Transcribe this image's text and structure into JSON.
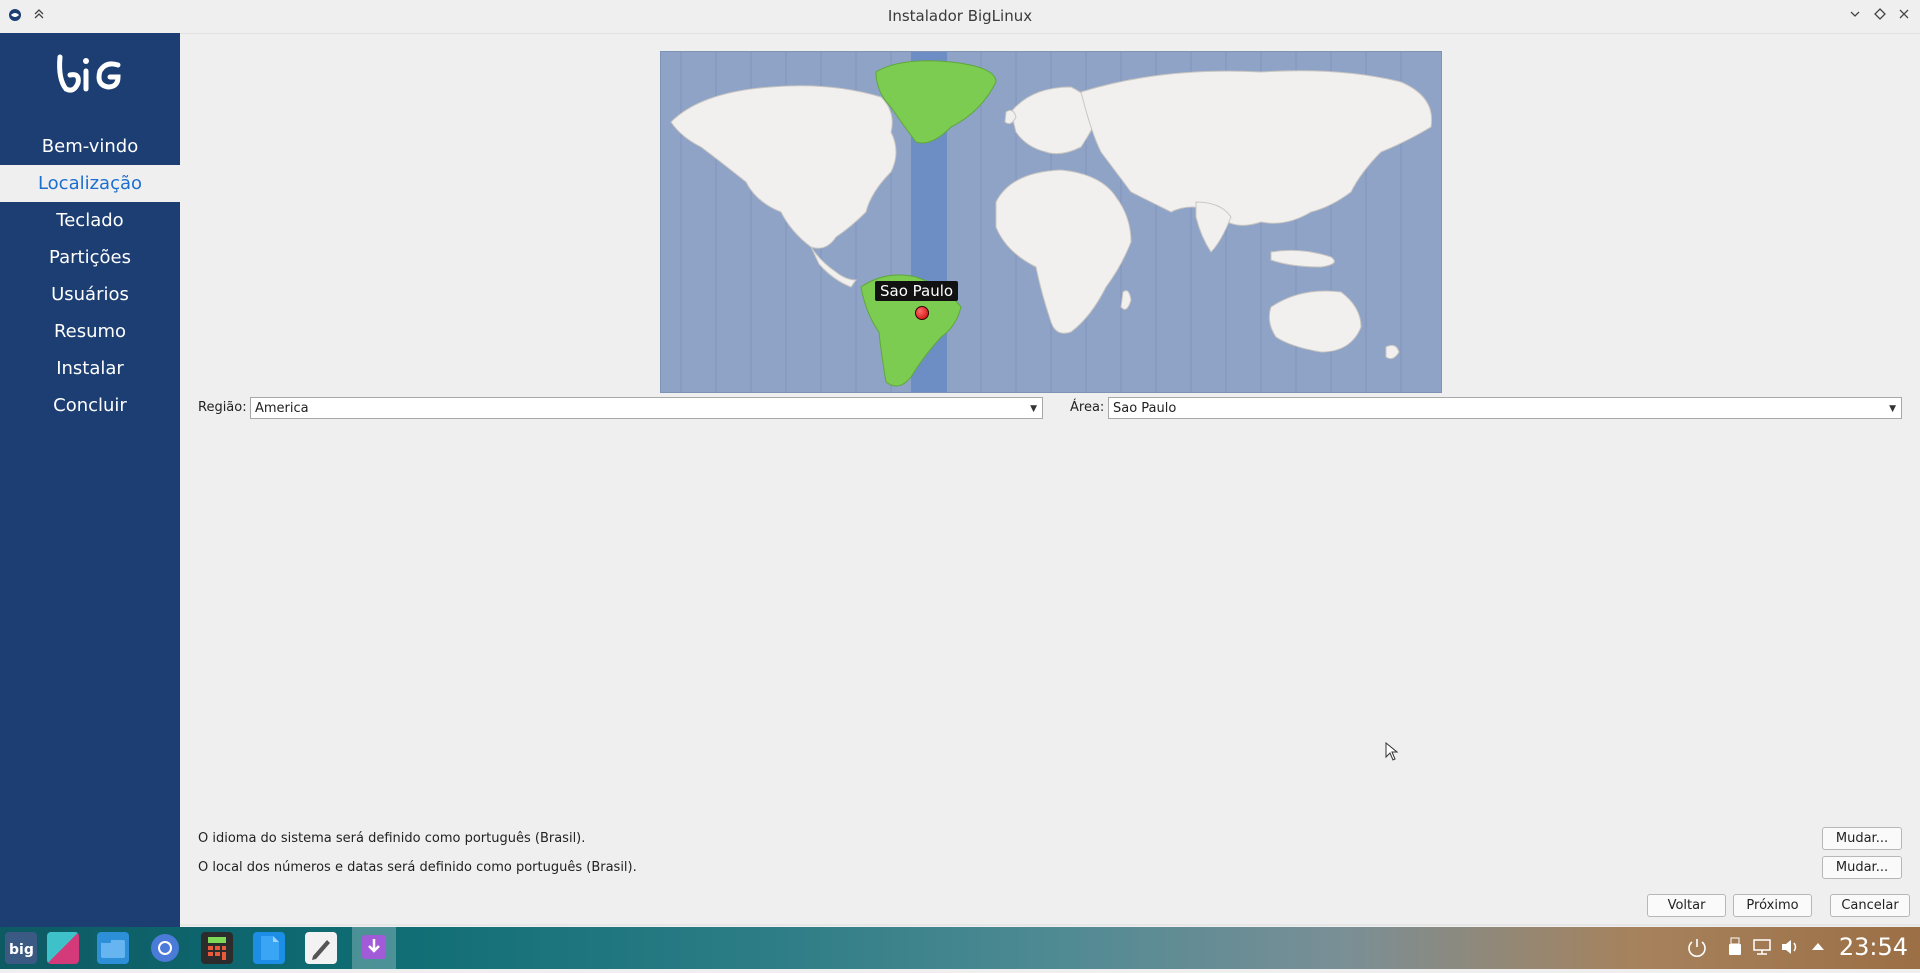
{
  "window": {
    "title": "Instalador BigLinux",
    "left_controls": [
      "app-menu-icon",
      "keep-above-icon"
    ],
    "right_controls": [
      "minimize-icon",
      "maximize-icon",
      "close-icon"
    ]
  },
  "sidebar": {
    "logo_text": "big",
    "items": [
      {
        "label": "Bem-vindo",
        "active": false
      },
      {
        "label": "Localização",
        "active": true
      },
      {
        "label": "Teclado",
        "active": false
      },
      {
        "label": "Partições",
        "active": false
      },
      {
        "label": "Usuários",
        "active": false
      },
      {
        "label": "Resumo",
        "active": false
      },
      {
        "label": "Instalar",
        "active": false
      },
      {
        "label": "Concluir",
        "active": false
      }
    ]
  },
  "map": {
    "selected_city": "Sao Paulo",
    "colors": {
      "ocean": "#8fa3c6",
      "land": "#f2f0ee",
      "selected": "#7ccc52",
      "zone_band": "#6d8ec4"
    }
  },
  "region": {
    "label": "Região:",
    "value": "America"
  },
  "area": {
    "label": "Área:",
    "value": "Sao Paulo"
  },
  "locale": {
    "language_text": "O idioma do sistema será definido como português (Brasil).",
    "formats_text": "O local dos números e datas será definido como português (Brasil).",
    "change_label": "Mudar..."
  },
  "nav_buttons": {
    "back": "Voltar",
    "next": "Próximo",
    "cancel": "Cancelar"
  },
  "taskbar": {
    "apps": [
      "big-menu-icon",
      "kdeconnect-icon",
      "file-manager-icon",
      "browser-icon",
      "calculator-icon",
      "document-icon",
      "text-editor-icon",
      "installer-icon"
    ],
    "tray": [
      "power-icon",
      "usb-icon",
      "network-icon",
      "volume-icon",
      "expand-tray-icon"
    ],
    "clock": "23:54"
  }
}
